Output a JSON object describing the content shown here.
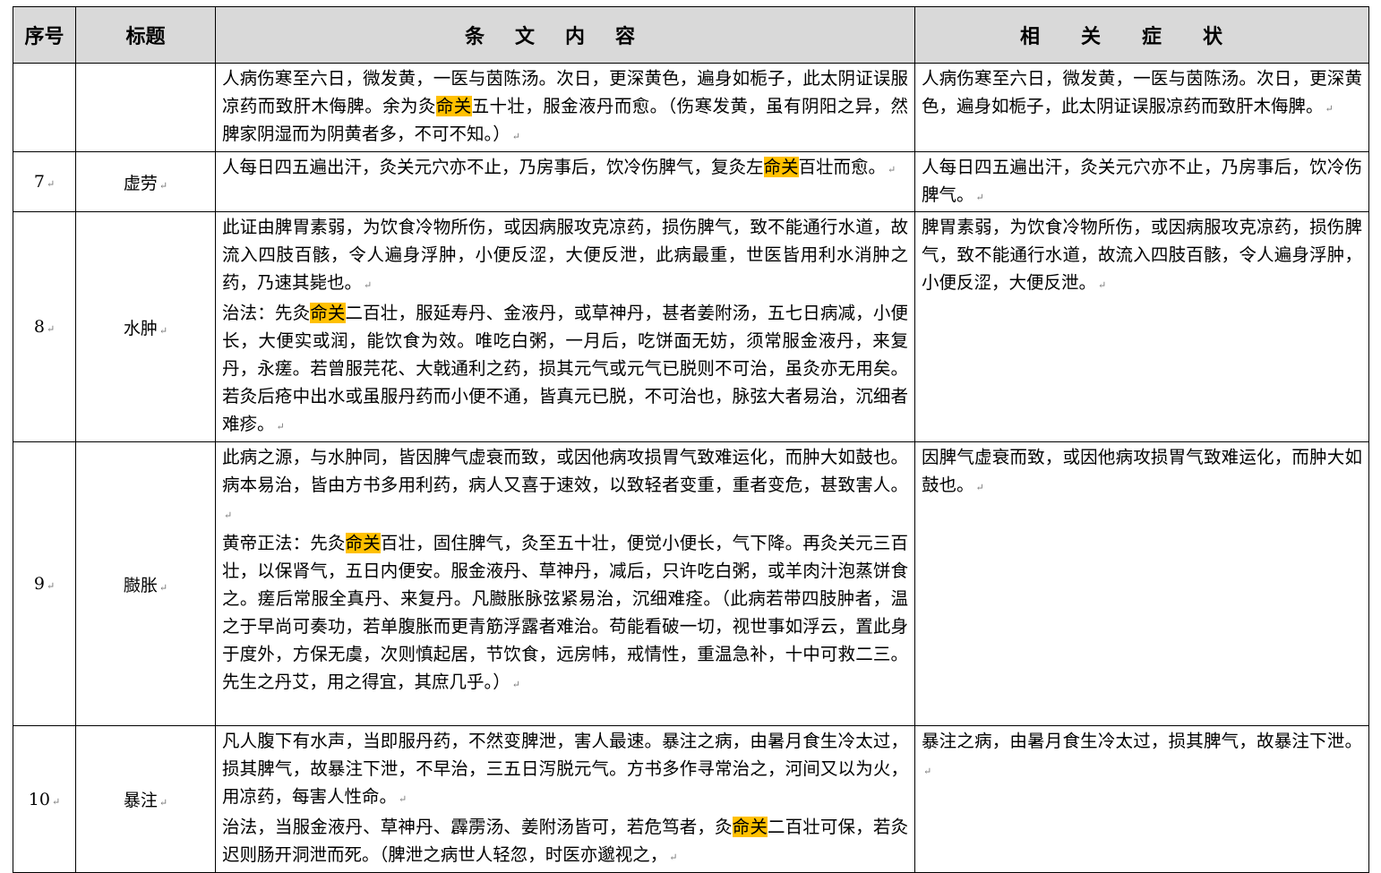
{
  "headers": {
    "num": "序号",
    "title": "标题",
    "content": "条文内容",
    "symptoms": "相关症状"
  },
  "highlight": "命关",
  "rows": [
    {
      "num": "",
      "title": "",
      "content": [
        [
          "人病伤寒至六日，微发黄，一医与茵陈汤。次日，更深黄色，遍身如栀子，此太阴证误服凉药而致肝木侮脾。余为灸",
          "命关",
          "五十壮，服金液丹而愈。（伤寒发黄，虽有阴阳之异，然脾家阴湿而为阴黄者多，不可不知。）"
        ]
      ],
      "symptoms": "人病伤寒至六日，微发黄，一医与茵陈汤。次日，更深黄色，遍身如栀子，此太阴证误服凉药而致肝木侮脾。"
    },
    {
      "num": "7",
      "title": "虚劳",
      "content": [
        [
          "人每日四五遍出汗，灸关元穴亦不止，乃房事后，饮冷伤脾气，复灸左",
          "命关",
          "百壮而愈。"
        ]
      ],
      "symptoms": "人每日四五遍出汗，灸关元穴亦不止，乃房事后，饮冷伤脾气。"
    },
    {
      "num": "8",
      "title": "水肿",
      "content": [
        [
          "此证由脾胃素弱，为饮食冷物所伤，或因病服攻克凉药，损伤脾气，致不能通行水道，故流入四肢百骸，令人遍身浮肿，小便反涩，大便反泄，此病最重，世医皆用利水消肿之药，乃速其毙也。",
          "",
          ""
        ],
        [
          "治法：先灸",
          "命关",
          "二百壮，服延寿丹、金液丹，或草神丹，甚者姜附汤，五七日病减，小便长，大便实或润，能饮食为效。唯吃白粥，一月后，吃饼面无妨，须常服金液丹，来复丹，永瘥。若曾服芫花、大戟通利之药，损其元气或元气已脱则不可治，虽灸亦无用矣。若灸后疮中出水或虽服丹药而小便不通，皆真元已脱，不可治也，脉弦大者易治，沉细者难疹。"
        ]
      ],
      "symptoms": "脾胃素弱，为饮食冷物所伤，或因病服攻克凉药，损伤脾气，致不能通行水道，故流入四肢百骸，令人遍身浮肿，小便反涩，大便反泄。"
    },
    {
      "num": "9",
      "title": "臌胀",
      "content": [
        [
          "此病之源，与水肿同，皆因脾气虚衰而致，或因他病攻损胃气致难运化，而肿大如鼓也。病本易治，皆由方书多用利药，病人又喜于速效，以致轻者变重，重者变危，甚致害人。",
          "",
          ""
        ],
        [
          "黄帝正法：先灸",
          "命关",
          "百壮，固住脾气，灸至五十壮，便觉小便长，气下降。再灸关元三百壮，以保肾气，五日内便安。服金液丹、草神丹，减后，只许吃白粥，或羊肉汁泡蒸饼食之。瘥后常服全真丹、来复丹。凡臌胀脉弦紧易治，沉细难痊。（此病若带四肢肿者，温之于早尚可奏功，若单腹胀而更青筋浮露者难治。苟能看破一切，视世事如浮云，置此身于度外，方保无虞，次则慎起居，节饮食，远房帏，戒情性，重温急补，十中可救二三。先生之丹艾，用之得宜，其庶几乎。）"
        ]
      ],
      "symptoms": "因脾气虚衰而致，或因他病攻损胃气致难运化，而肿大如鼓也。"
    },
    {
      "num": "10",
      "title": "暴注",
      "content": [
        [
          "凡人腹下有水声，当即服丹药，不然变脾泄，害人最速。暴注之病，由暑月食生冷太过，损其脾气，故暴注下泄，不早治，三五日泻脱元气。方书多作寻常治之，河间又以为火，用凉药，每害人性命。",
          "",
          ""
        ],
        [
          "治法，当服金液丹、草神丹、霹雳汤、姜附汤皆可，若危笃者，灸",
          "命关",
          "二百壮可保，若灸迟则肠开洞泄而死。（脾泄之病世人轻忽，时医亦邈视之，"
        ]
      ],
      "symptoms": "暴注之病，由暑月食生冷太过，损其脾气，故暴注下泄。"
    }
  ]
}
